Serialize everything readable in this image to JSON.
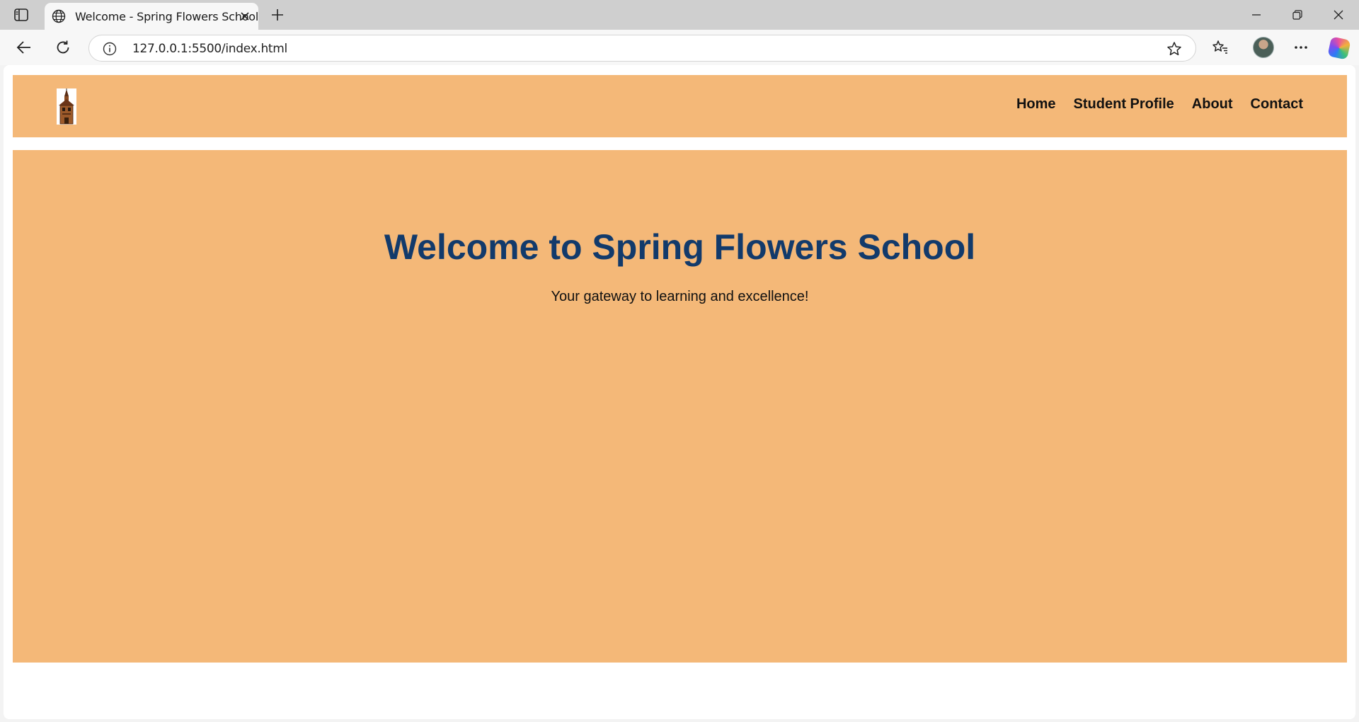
{
  "browser": {
    "tab_title": "Welcome - Spring Flowers School",
    "url": "127.0.0.1:5500/index.html",
    "icons": [
      "sidebar-toggle-icon",
      "globe-icon",
      "close-icon",
      "plus-icon",
      "minimize-icon",
      "restore-icon",
      "window-close-icon",
      "back-icon",
      "refresh-icon",
      "info-icon",
      "star-icon",
      "favorites-icon",
      "avatar",
      "more-icon",
      "copilot-icon"
    ]
  },
  "site": {
    "nav": [
      {
        "label": "Home"
      },
      {
        "label": "Student Profile"
      },
      {
        "label": "About"
      },
      {
        "label": "Contact"
      }
    ],
    "hero": {
      "title": "Welcome to Spring Flowers School",
      "subtitle": "Your gateway to learning and excellence!"
    },
    "colors": {
      "header_bg": "#f4b878",
      "title_color": "#123a6b"
    }
  }
}
